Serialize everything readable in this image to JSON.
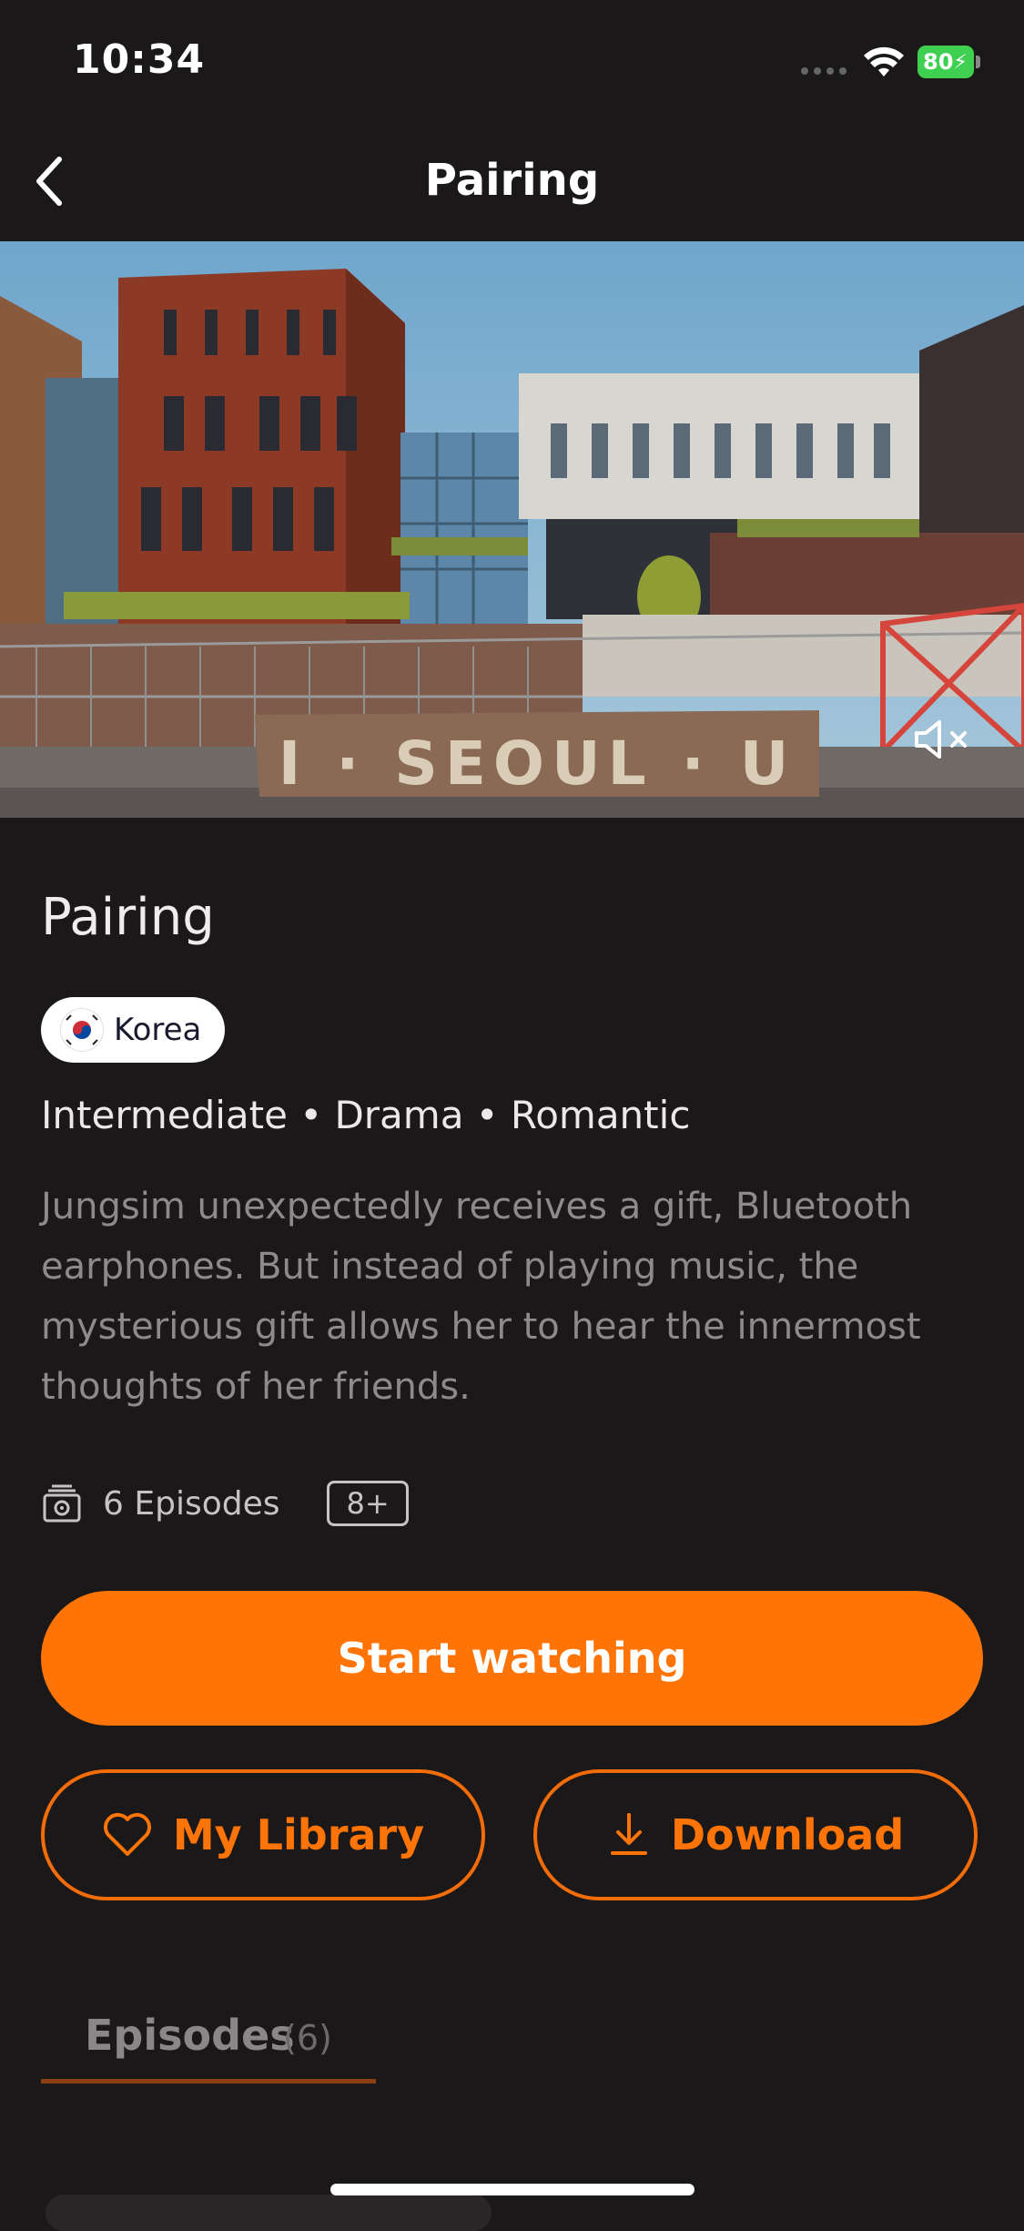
{
  "status_bar": {
    "time": "10:34",
    "battery_level": "80"
  },
  "nav": {
    "title": "Pairing",
    "back_icon": "chevron-left-icon"
  },
  "hero": {
    "sign_text": "I · SEOUL · U",
    "mute_icon": "speaker-muted-icon"
  },
  "show": {
    "title": "Pairing",
    "country": "Korea",
    "tags": "Intermediate • Drama • Romantic",
    "description": "Jungsim unexpectedly receives a gift, Bluetooth earphones. But instead of playing music, the mysterious gift allows her to hear the innermost thoughts of her friends.",
    "episodes_label": "6 Episodes",
    "age_rating": "8+"
  },
  "actions": {
    "start_label": "Start watching",
    "library_label": "My Library",
    "download_label": "Download"
  },
  "tabs": {
    "episodes_label": "Episodes",
    "episodes_count": "(6)"
  },
  "colors": {
    "accent": "#ff7406",
    "background": "#1b181a",
    "text_muted": "#8d8a8c"
  }
}
